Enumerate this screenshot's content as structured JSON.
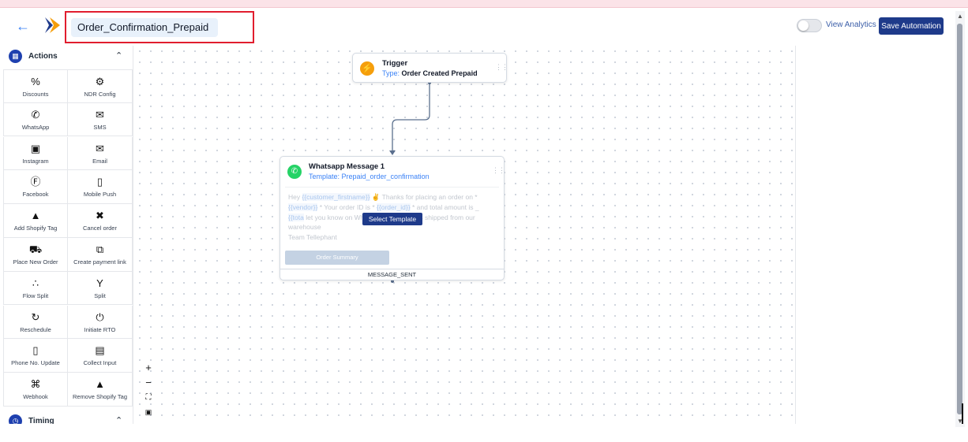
{
  "header": {
    "back_icon": "arrow-left-icon",
    "automation_name": "Order_Confirmation_Prepaid",
    "view_analytics_label": "View Analytics",
    "save_label": "Save Automation",
    "toggle_state": "off"
  },
  "sidebar": {
    "actions_title": "Actions",
    "timing_title": "Timing",
    "actions": [
      {
        "label": "Discounts",
        "icon": "percent-icon"
      },
      {
        "label": "NDR Config",
        "icon": "gear-icon"
      },
      {
        "label": "WhatsApp",
        "icon": "whatsapp-icon"
      },
      {
        "label": "SMS",
        "icon": "sms-icon"
      },
      {
        "label": "Instagram",
        "icon": "instagram-icon"
      },
      {
        "label": "Email",
        "icon": "email-icon"
      },
      {
        "label": "Facebook",
        "icon": "facebook-icon"
      },
      {
        "label": "Mobile Push",
        "icon": "mobile-push-icon"
      },
      {
        "label": "Add Shopify Tag",
        "icon": "shopify-bag-icon"
      },
      {
        "label": "Cancel order",
        "icon": "cart-cancel-icon"
      },
      {
        "label": "Place New Order",
        "icon": "cart-icon"
      },
      {
        "label": "Create payment link",
        "icon": "payment-link-icon"
      },
      {
        "label": "Flow Split",
        "icon": "flow-split-icon"
      },
      {
        "label": "Split",
        "icon": "split-icon"
      },
      {
        "label": "Reschedule",
        "icon": "reschedule-icon"
      },
      {
        "label": "Initiate RTO",
        "icon": "power-icon"
      },
      {
        "label": "Phone No. Update",
        "icon": "phone-update-icon"
      },
      {
        "label": "Collect Input",
        "icon": "collect-input-icon"
      },
      {
        "label": "Webhook",
        "icon": "webhook-icon"
      },
      {
        "label": "Remove Shopify Tag",
        "icon": "shopify-bag-icon"
      }
    ]
  },
  "trigger_node": {
    "title": "Trigger",
    "type_label": "Type:",
    "type_value": "Order Created Prepaid"
  },
  "whatsapp_node": {
    "title": "Whatsapp Message 1",
    "template_label": "Template: Prepaid_order_confirmation",
    "message": {
      "p1": "Hey",
      "v1": "{{customer_firstname}}",
      "p2": "Thanks for placing an order on *",
      "v2": "{{vendor}}",
      "p3": "* Your order ID is *",
      "v3": "{{order_id}}",
      "p4": "* and total amount is _",
      "v4": "{{tota",
      "p5": "let you know on WhatsApp when it gets shipped from our warehouse",
      "p6": "Team Tellephant"
    },
    "select_template_label": "Select Template",
    "order_summary_label": "Order Summary",
    "footer_label": "MESSAGE_SENT"
  },
  "colors": {
    "primary": "#1e3a8a",
    "accent_blue": "#3b82f6",
    "highlight_border": "#e11d2e",
    "whatsapp_green": "#25d366",
    "trigger_orange": "#f59e0b"
  }
}
